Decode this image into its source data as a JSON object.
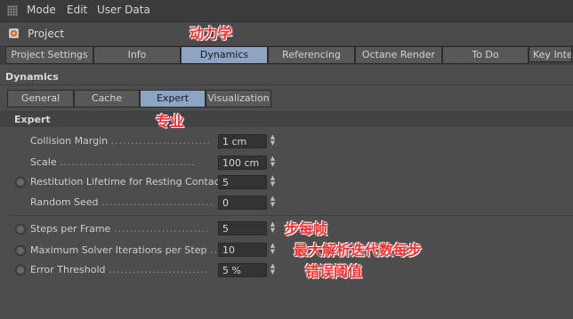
{
  "menu": {
    "items": [
      "Mode",
      "Edit",
      "User Data"
    ]
  },
  "header": {
    "title": "Project"
  },
  "tabs": [
    {
      "label": "Project Settings",
      "active": false
    },
    {
      "label": "Info",
      "active": false
    },
    {
      "label": "Dynamics",
      "active": true
    },
    {
      "label": "Referencing",
      "active": false
    },
    {
      "label": "Octane Render",
      "active": false
    },
    {
      "label": "To Do",
      "active": false
    },
    {
      "label": "Key Inter",
      "active": false
    }
  ],
  "section": {
    "title": "Dynamics"
  },
  "subtabs": [
    {
      "label": "General",
      "active": false
    },
    {
      "label": "Cache",
      "active": false
    },
    {
      "label": "Expert",
      "active": true
    },
    {
      "label": "Visualization",
      "active": false
    }
  ],
  "group": {
    "title": "Expert"
  },
  "params": [
    {
      "label": "Collision Margin",
      "value": "1 cm"
    },
    {
      "label": "Scale",
      "value": "100 cm"
    },
    {
      "label": "Restitution Lifetime for Resting Contact",
      "value": "5"
    },
    {
      "label": "Random Seed",
      "value": "0"
    },
    {
      "label": "Steps per Frame",
      "value": "5"
    },
    {
      "label": "Maximum Solver Iterations per Step",
      "value": "10"
    },
    {
      "label": "Error Threshold",
      "value": "5 %"
    }
  ],
  "annotations": {
    "dynamics": "动力学",
    "expert": "专业",
    "steps_per_frame": "步每帧",
    "max_iterations": "最大解析迭代数每步",
    "error_threshold": "错误阈值"
  },
  "colors": {
    "accent_tab": "#8ea4c4",
    "annotation": "#ff2d2d",
    "panel_bg": "#4d4d4d"
  }
}
